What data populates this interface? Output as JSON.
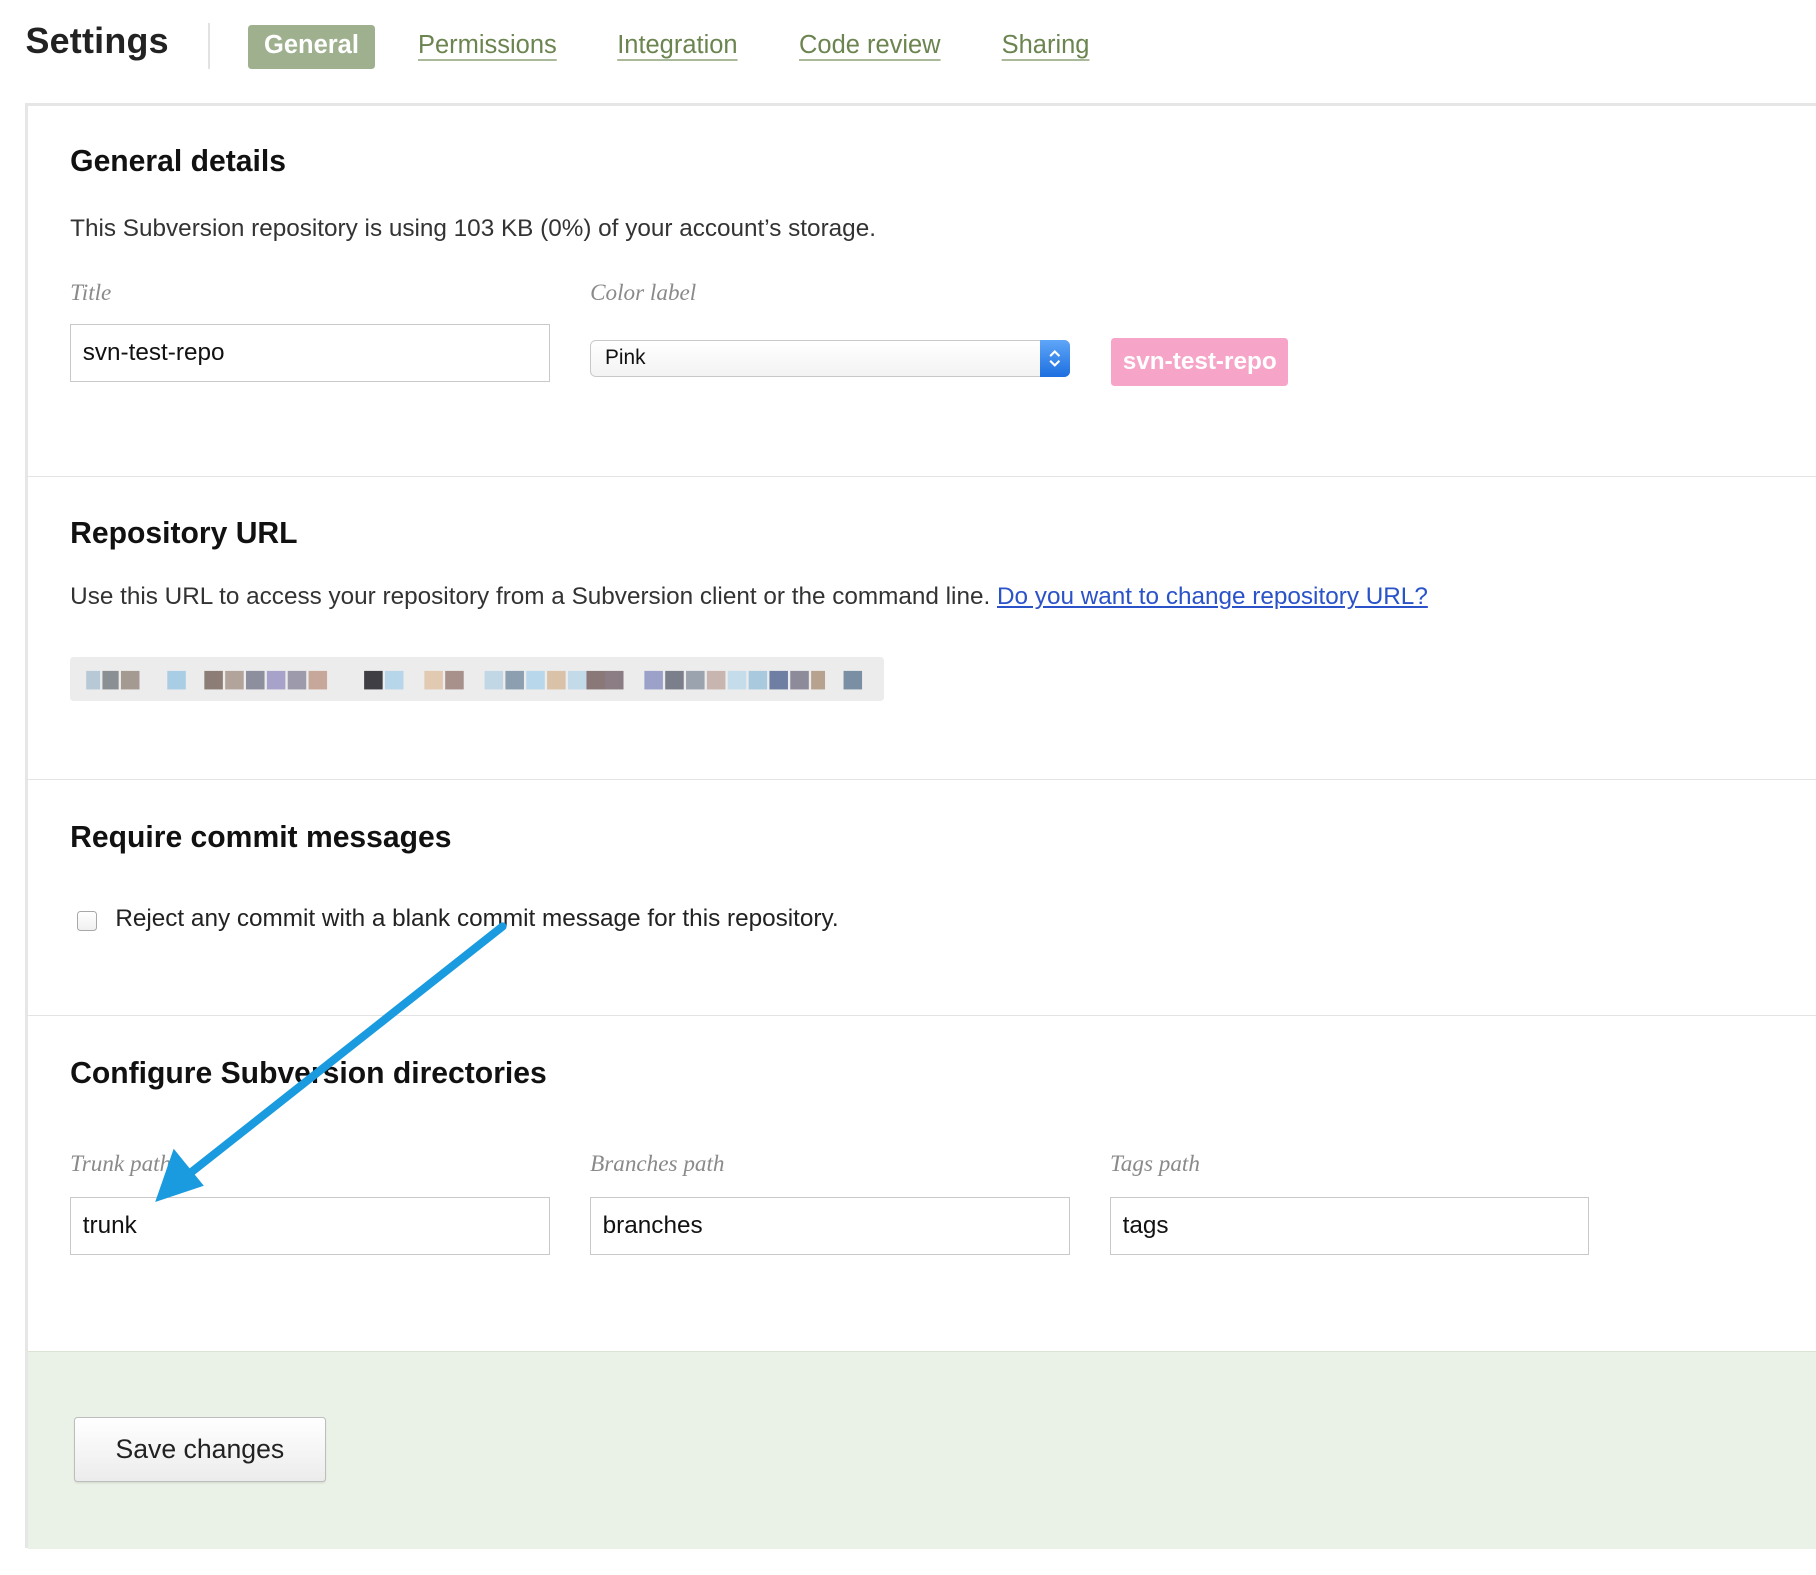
{
  "header": {
    "title": "Settings",
    "tabs": [
      {
        "label": "General",
        "active": true
      },
      {
        "label": "Permissions",
        "active": false
      },
      {
        "label": "Integration",
        "active": false
      },
      {
        "label": "Code review",
        "active": false
      },
      {
        "label": "Sharing",
        "active": false
      }
    ]
  },
  "general": {
    "heading": "General details",
    "description": "This Subversion repository is using 103 KB (0%) of your account’s storage.",
    "title_label": "Title",
    "title_value": "svn-test-repo",
    "color_label": "Color label",
    "color_value": "Pink",
    "badge_text": "svn-test-repo",
    "badge_color": "#f6a5c8"
  },
  "repository_url": {
    "heading": "Repository URL",
    "description": "Use this URL to access your repository from a Subversion client or the command line.",
    "change_link": "Do you want to change repository URL?"
  },
  "commit_messages": {
    "heading": "Require commit messages",
    "checkbox_label": "Reject any commit with a blank commit message for this repository.",
    "checked": false
  },
  "directories": {
    "heading": "Configure Subversion directories",
    "trunk_label": "Trunk path",
    "trunk_value": "trunk",
    "branches_label": "Branches path",
    "branches_value": "branches",
    "tags_label": "Tags path",
    "tags_value": "tags"
  },
  "footer": {
    "save_label": "Save changes"
  },
  "colors": {
    "tab_active_bg": "#9fb08e",
    "tab_link": "#6b8450",
    "link": "#2a52c9",
    "footer_bg": "#eaf1e6",
    "annotation_arrow": "#1a9be0"
  }
}
